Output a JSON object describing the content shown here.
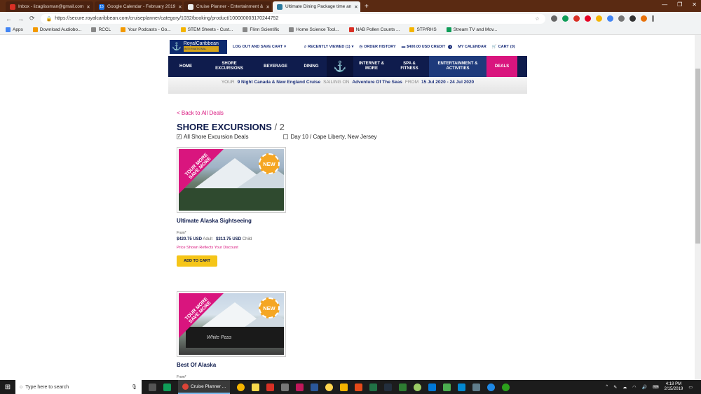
{
  "browser": {
    "tabs": [
      {
        "title": "Inbox - lizaglissman@gmail.com",
        "icon_color": "#d93025",
        "active": false
      },
      {
        "title": "Google Calendar - February 2019",
        "icon_color": "#1a73e8",
        "icon_text": "15",
        "active": false
      },
      {
        "title": "Cruise Planner - Entertainment &",
        "icon_color": "#eeeeee",
        "active": false
      },
      {
        "title": "Ultimate Dining Package time an",
        "icon_color": "#2b7a9e",
        "active": true
      }
    ],
    "url": "https://secure.royalcaribbean.com/cruiseplanner/category/1032/booking/product/100000003170244752",
    "bookmarks": [
      {
        "label": "Apps",
        "icon_color": "#4285f4"
      },
      {
        "label": "Download Audiobo...",
        "icon_color": "#f29900"
      },
      {
        "label": "RCCL",
        "icon_color": "#888888"
      },
      {
        "label": "Your Podcasts - Go...",
        "icon_color": "#f29900"
      },
      {
        "label": "STEM Sheets - Cust...",
        "icon_color": "#f4b400"
      },
      {
        "label": "Flinn Scientific",
        "icon_color": "#888888"
      },
      {
        "label": "Home Science Tool...",
        "icon_color": "#888888"
      },
      {
        "label": "NAB Pollen Counts ...",
        "icon_color": "#d93025"
      },
      {
        "label": "STP/RHS",
        "icon_color": "#f4b400"
      },
      {
        "label": "Stream TV and Mov...",
        "icon_color": "#0f9d58"
      }
    ]
  },
  "site": {
    "logo_main": "RoyalCaribbean",
    "logo_sub": "INTERNATIONAL",
    "top_links": {
      "logout": "LOG OUT AND SAVE CART",
      "recently_viewed": "RECENTLY VIEWED (1)",
      "order_history": "ORDER HISTORY",
      "credit": "$400.00 USD CREDIT",
      "calendar": "MY CALENDAR",
      "cart": "CART",
      "cart_count": "(0)"
    },
    "nav": {
      "home": "HOME",
      "shore": "SHORE EXCURSIONS",
      "beverage": "BEVERAGE",
      "dining": "DINING",
      "internet": "INTERNET & MORE",
      "spa": "SPA & FITNESS",
      "entertainment": "ENTERTAINMENT & ACTIVITIES",
      "deals": "DEALS"
    },
    "sailing": {
      "your": "YOUR",
      "cruise": "9 Night Canada & New England Cruise",
      "sailing_on": "SAILING ON",
      "ship": "Adventure Of The Seas",
      "from": "FROM",
      "dates": "15 Jul 2020 - 24 Jul 2020"
    }
  },
  "page": {
    "back_link": "< Back to All Deals",
    "heading": "SHORE EXCURSIONS",
    "heading_count": "/ 2",
    "filters": [
      {
        "label": "All Shore Excursion Deals",
        "checked": true
      },
      {
        "label": "Day 10 / Cape Liberty, New Jersey",
        "checked": false
      }
    ],
    "ribbon_line1": "TOUR MORE",
    "ribbon_line2": "SAVE MORE",
    "new_badge": "NEW",
    "products": [
      {
        "title": "Ultimate Alaska Sightseeing",
        "from": "From*",
        "adult_price": "$420.75 USD",
        "adult_label": "Adult",
        "child_price": "$313.75 USD",
        "child_label": "Child",
        "discount_note": "Price Shown Reflects Your Discount",
        "button": "ADD TO CART"
      },
      {
        "title": "Best Of Alaska",
        "from": "From*",
        "train_label": "White Pass"
      }
    ]
  },
  "taskbar": {
    "search_placeholder": "Type here to search",
    "active_app": "Cruise Planner ...",
    "time": "4:18 PM",
    "date": "2/15/2019"
  }
}
